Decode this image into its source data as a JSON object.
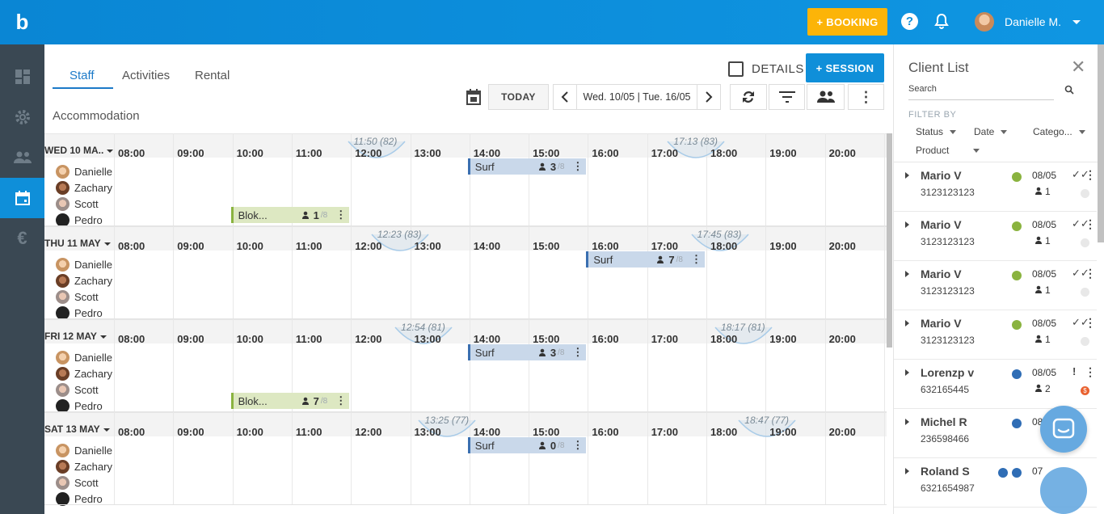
{
  "topbar": {
    "logo": "b",
    "booking_label": "+ BOOKING",
    "user_name": "Danielle M."
  },
  "sidebar": {
    "items": [
      {
        "icon": "dashboard-icon"
      },
      {
        "icon": "gear-icon"
      },
      {
        "icon": "people-icon"
      },
      {
        "icon": "calendar-icon",
        "active": true
      },
      {
        "icon": "euro-icon"
      }
    ]
  },
  "tabs": [
    "Staff",
    "Activities",
    "Rental",
    "Accommodation"
  ],
  "toolbar": {
    "details_label": "DETAILS",
    "session_label": "+ SESSION",
    "today_label": "TODAY",
    "date_range": "Wed. 10/05 | Tue. 16/05"
  },
  "hours": [
    "08:00",
    "09:00",
    "10:00",
    "11:00",
    "12:00",
    "13:00",
    "14:00",
    "15:00",
    "16:00",
    "17:00",
    "18:00",
    "19:00",
    "20:00"
  ],
  "staff": [
    "Danielle",
    "Zachary",
    "Scott",
    "Pedro"
  ],
  "days": [
    {
      "label": "WED 10 MA..",
      "sunrise": "11:50 (82)",
      "sunset": "17:13 (83)",
      "events": [
        {
          "name": "Surf",
          "count": "3",
          "cap": "/8",
          "type": "surf"
        },
        {
          "name": "Blok...",
          "count": "1",
          "cap": "/8",
          "type": "blok"
        }
      ]
    },
    {
      "label": "THU 11 MAY",
      "sunrise": "12:23 (83)",
      "sunset": "17:45 (83)",
      "events": [
        {
          "name": "Surf",
          "count": "7",
          "cap": "/8",
          "type": "surf"
        }
      ]
    },
    {
      "label": "FRI 12 MAY",
      "sunrise": "12:54 (81)",
      "sunset": "18:17 (81)",
      "events": [
        {
          "name": "Surf",
          "count": "3",
          "cap": "/8",
          "type": "surf"
        },
        {
          "name": "Blok...",
          "count": "7",
          "cap": "/8",
          "type": "blok"
        }
      ]
    },
    {
      "label": "SAT 13 MAY",
      "sunrise": "13:25 (77)",
      "sunset": "18:47 (77)",
      "events": [
        {
          "name": "Surf",
          "count": "0",
          "cap": "/8",
          "type": "surf"
        }
      ]
    }
  ],
  "client_panel": {
    "title": "Client List",
    "search_placeholder": "Search",
    "filter_by": "FILTER BY",
    "filters": [
      "Status",
      "Date",
      "Catego...",
      "Product"
    ],
    "clients": [
      {
        "name": "Mario V",
        "phone": "3123123123",
        "date": "08/05",
        "persons": "1",
        "status": "✓✓",
        "dots": [
          "#8ab33f"
        ]
      },
      {
        "name": "Mario V",
        "phone": "3123123123",
        "date": "08/05",
        "persons": "1",
        "status": "✓✓",
        "dots": [
          "#8ab33f"
        ]
      },
      {
        "name": "Mario V",
        "phone": "3123123123",
        "date": "08/05",
        "persons": "1",
        "status": "✓✓",
        "dots": [
          "#8ab33f"
        ]
      },
      {
        "name": "Mario V",
        "phone": "3123123123",
        "date": "08/05",
        "persons": "1",
        "status": "✓✓",
        "dots": [
          "#8ab33f"
        ]
      },
      {
        "name": "Lorenzp v",
        "phone": "632165445",
        "date": "08/05",
        "persons": "2",
        "status": "!",
        "dots": [
          "#2f6db5"
        ],
        "payment": "$"
      },
      {
        "name": "Michel R",
        "phone": "236598466",
        "date": "08",
        "persons": "",
        "status": "",
        "dots": [
          "#2f6db5"
        ]
      },
      {
        "name": "Roland S",
        "phone": "6321654987",
        "date": "07",
        "persons": "",
        "status": "",
        "dots": [
          "#2f6db5",
          "#2f6db5"
        ]
      }
    ]
  },
  "colors": {
    "accent": "#0f8fd9",
    "booking": "#fcb408",
    "sidebar": "#3a4853"
  }
}
